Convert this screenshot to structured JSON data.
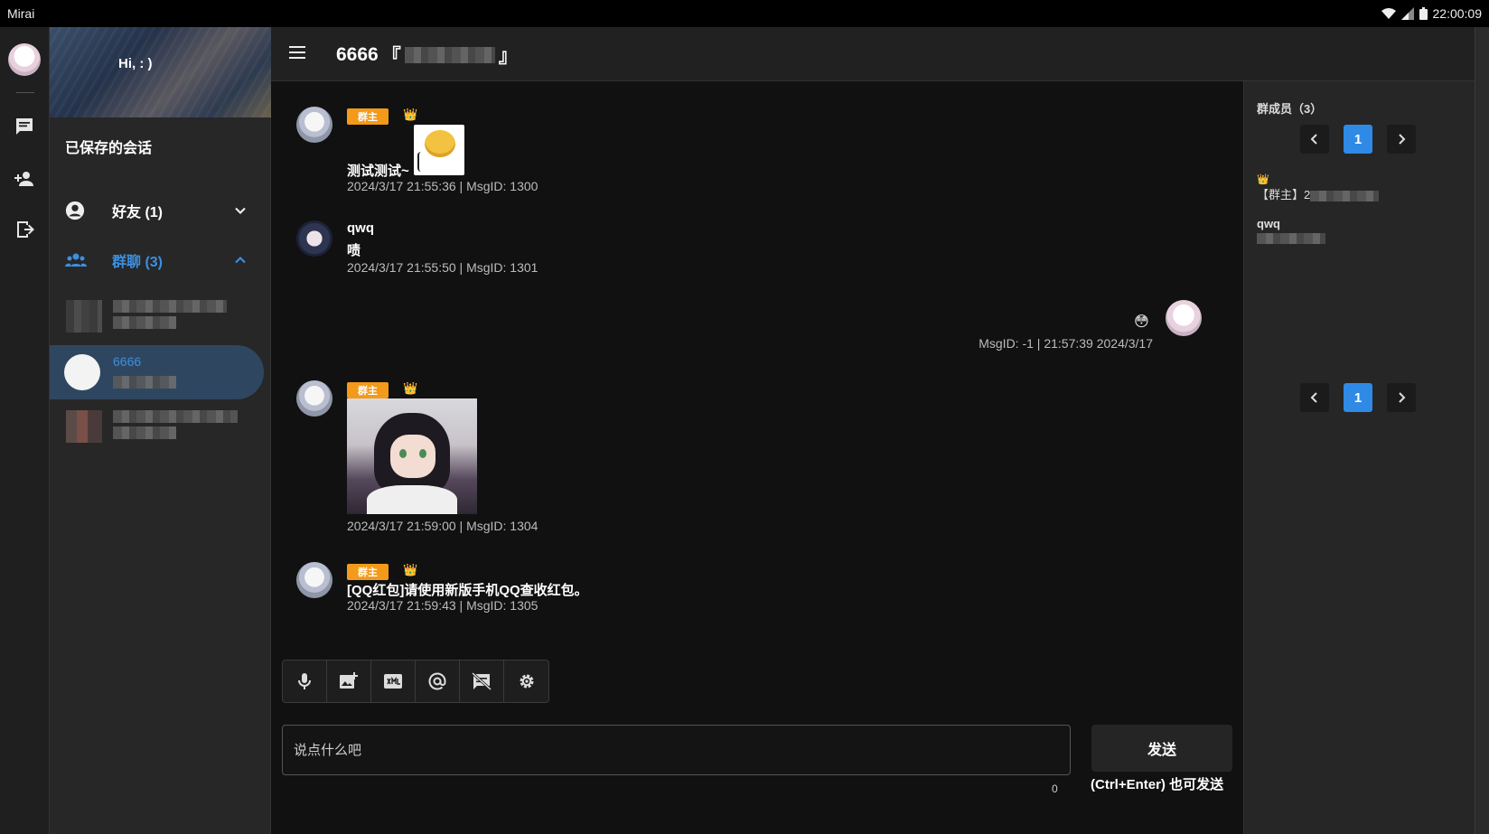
{
  "statusbar": {
    "app_name": "Mirai",
    "time": "22:00:09"
  },
  "sidebar": {
    "greeting": "Hi, : )",
    "saved_title": "已保存的会话",
    "friends_label": "好友 (1)",
    "groups_label": "群聊 (3)",
    "active_conversation_name": "6666"
  },
  "header": {
    "title_prefix": "6666",
    "bracket_open": "『",
    "bracket_close": "』"
  },
  "messages": [
    {
      "badge": "群主",
      "crown": "👑",
      "text": "测试测试~",
      "meta": "2024/3/17 21:55:36 | MsgID: 1300"
    },
    {
      "sender": "qwq",
      "text": "啧",
      "meta": "2024/3/17 21:55:50 | MsgID: 1301"
    },
    {
      "emoji": "😳",
      "meta": "MsgID: -1 | 21:57:39 2024/3/17"
    },
    {
      "badge": "群主",
      "crown": "👑",
      "meta": "2024/3/17 21:59:00 | MsgID: 1304"
    },
    {
      "badge": "群主",
      "crown": "👑",
      "text": "[QQ红包]请使用新版手机QQ查收红包。",
      "meta": "2024/3/17 21:59:43 | MsgID: 1305"
    }
  ],
  "composer": {
    "placeholder": "说点什么吧",
    "counter": "0",
    "send_label": "发送",
    "send_hint": "(Ctrl+Enter) 也可发送"
  },
  "members": {
    "title": "群成员（3）",
    "page": "1",
    "owner_crown": "👑",
    "owner_label": "【群主】2",
    "member2_name": "qwq"
  },
  "icons": [
    "menu-icon",
    "chat-icon",
    "add-person-icon",
    "logout-icon",
    "account-icon",
    "group-icon",
    "mic-icon",
    "image-add-icon",
    "xml-icon",
    "at-icon",
    "no-message-icon",
    "gear-icon"
  ]
}
